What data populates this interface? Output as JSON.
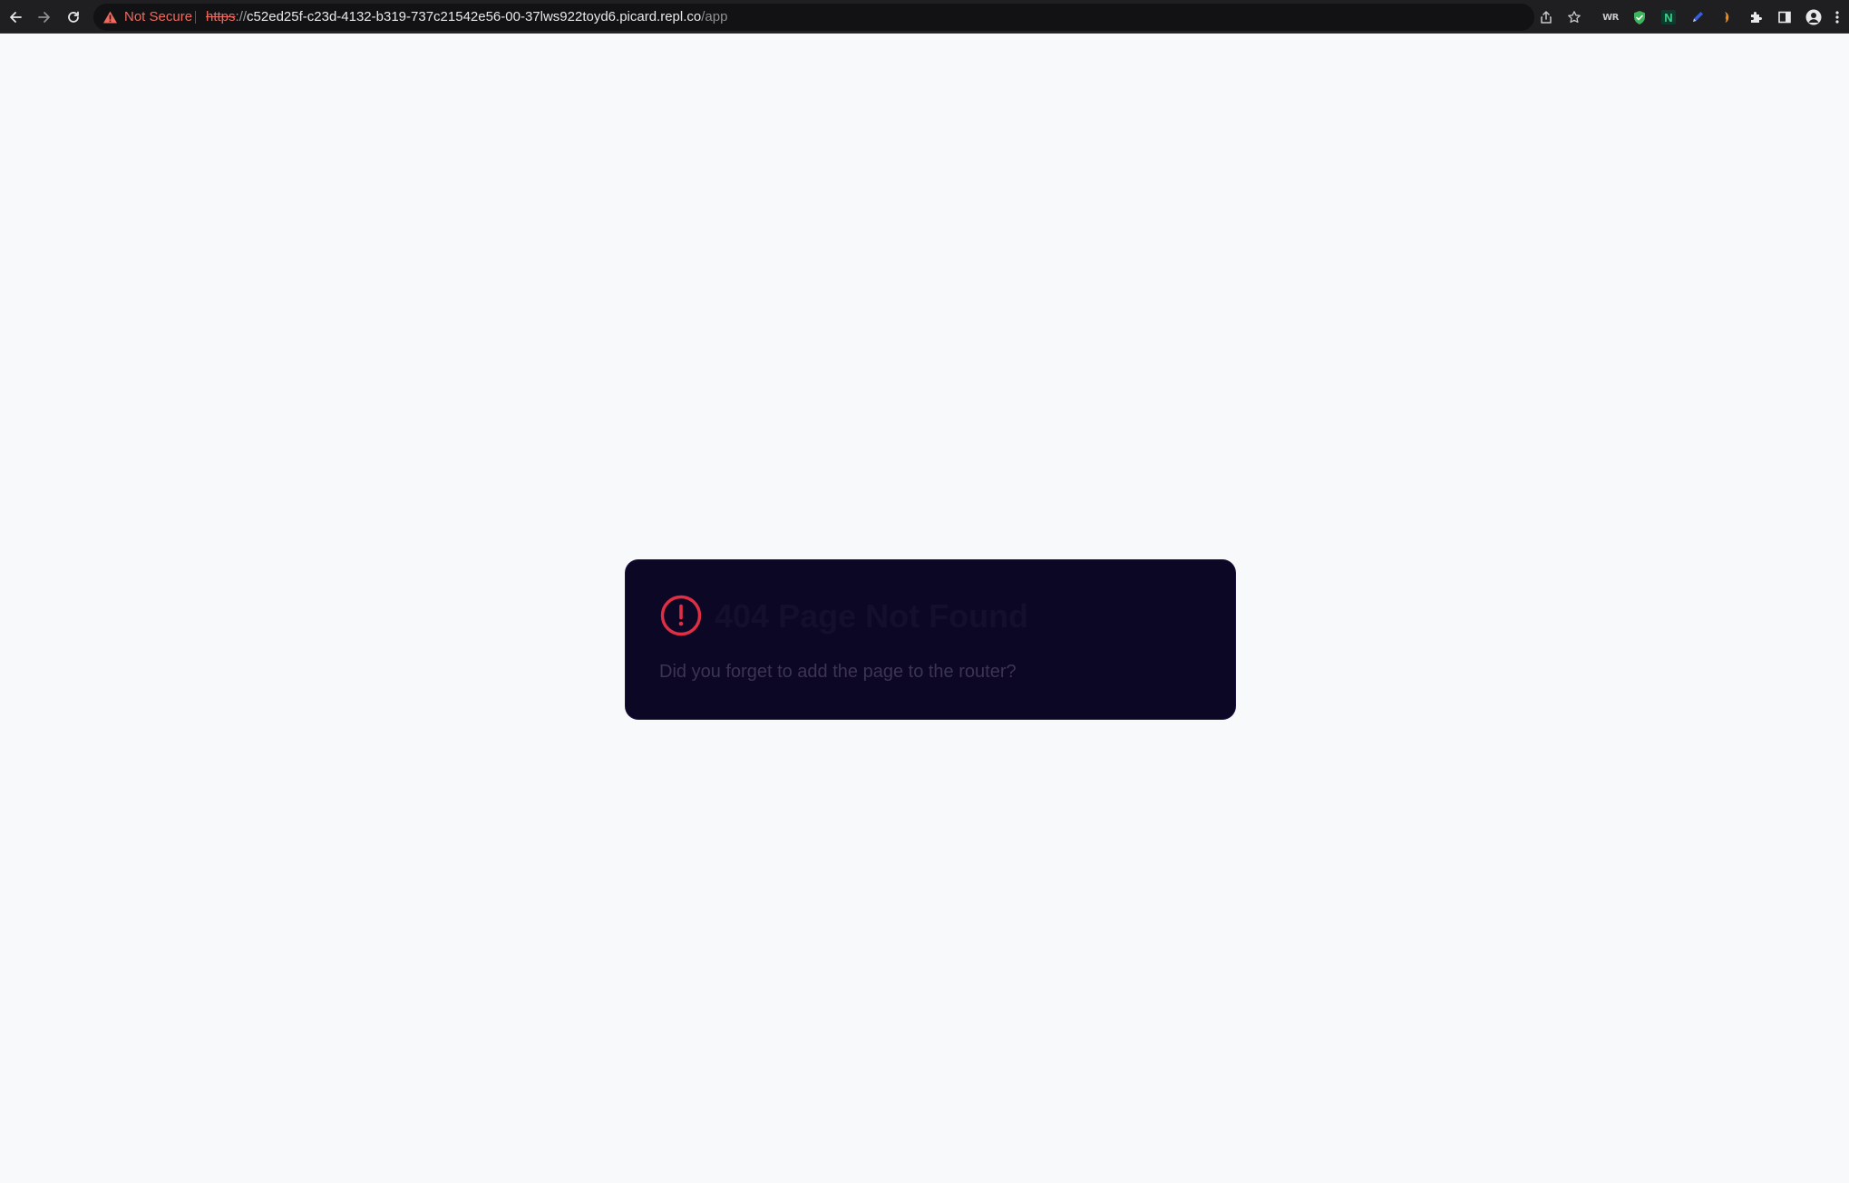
{
  "browser": {
    "security_label": "Not Secure",
    "url_scheme": "https",
    "url_separator": "://",
    "url_host": "c52ed25f-c23d-4132-b319-737c21542e56-00-37lws922toyd6.picard.repl.co",
    "url_path": "/app",
    "extensions": {
      "wr_label": "WR",
      "n_label": "N"
    },
    "colors": {
      "toolbar_bg": "#1f1f21",
      "warning": "#ee6a5f"
    }
  },
  "page": {
    "background": "#f8f9fb",
    "error_card": {
      "title": "404 Page Not Found",
      "message": "Did you forget to add the page to the router?",
      "icon": "alert-circle-icon",
      "colors": {
        "card_bg": "#0d0726",
        "icon": "#e02f45",
        "title": "#150f2e",
        "message": "#3b3551"
      }
    }
  }
}
